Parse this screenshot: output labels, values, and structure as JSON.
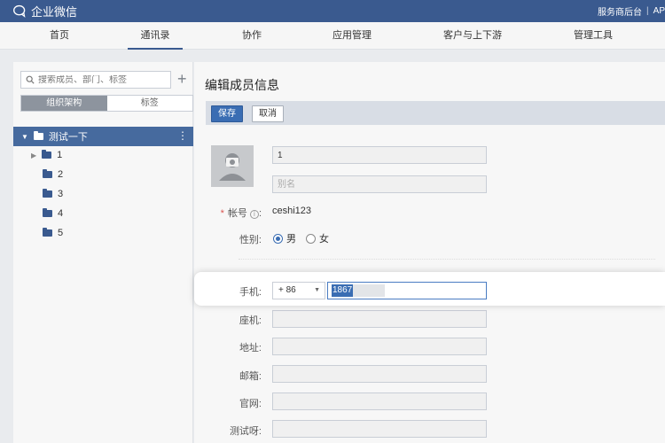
{
  "app": {
    "name": "企业微信",
    "links": [
      "服务商后台",
      "AP"
    ]
  },
  "nav": {
    "items": [
      "首页",
      "通讯录",
      "协作",
      "应用管理",
      "客户与上下游",
      "管理工具"
    ],
    "active": "通讯录"
  },
  "sidebar": {
    "search_placeholder": "搜索成员、部门、标签",
    "tabs": [
      "组织架构",
      "标签"
    ],
    "active_tab": "组织架构",
    "root": "测试一下",
    "departments": [
      "1",
      "2",
      "3",
      "4",
      "5"
    ]
  },
  "main": {
    "title": "编辑成员信息",
    "save_label": "保存",
    "cancel_label": "取消",
    "name_value": "1",
    "alias_placeholder": "别名",
    "account_label": "帐号",
    "account_value": "ceshi123",
    "gender_label": "性别:",
    "gender_options": [
      "男",
      "女"
    ],
    "gender_selected": "男",
    "phone_label": "手机:",
    "phone_country_code": "+ 86",
    "phone_value_visible": "1867",
    "landline_label": "座机:",
    "address_label": "地址:",
    "email_label": "邮箱:",
    "website_label": "官网:",
    "custom_label": "测试呀:"
  },
  "colors": {
    "top_bar": "#3a5a8f",
    "selected_dept": "#466a9e",
    "primary_button": "#3a6db3"
  }
}
